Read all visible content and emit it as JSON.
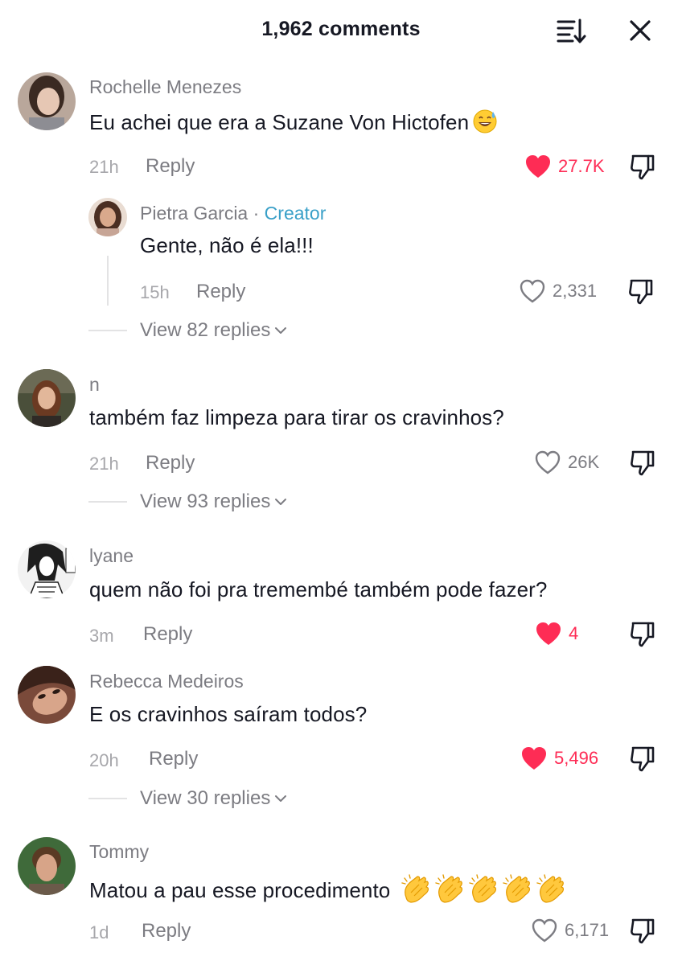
{
  "header": {
    "title": "1,962 comments"
  },
  "comments": [
    {
      "username": "Rochelle Menezes",
      "text": "Eu achei que era a Suzane Von Hictofen",
      "time": "21h",
      "reply_label": "Reply",
      "likes": "27.7K",
      "liked": true,
      "avatar_colors": [
        "#c9b3a3",
        "#3a2a22",
        "#e8d2c3"
      ],
      "replies": [
        {
          "username": "Pietra Garcia",
          "separator": "·",
          "badge": "Creator",
          "text": "Gente, não é ela!!!",
          "time": "15h",
          "reply_label": "Reply",
          "likes": "2,331",
          "liked": false
        }
      ],
      "view_replies": "View 82 replies"
    },
    {
      "username": "n",
      "text": "também faz limpeza para tirar os cravinhos?",
      "time": "21h",
      "reply_label": "Reply",
      "likes": "26K",
      "liked": false,
      "view_replies": "View 93 replies"
    },
    {
      "username": "lyane",
      "text": "quem não foi pra tremembé também pode fazer?",
      "time": "3m",
      "reply_label": "Reply",
      "likes": "4",
      "liked": true
    },
    {
      "username": "Rebecca Medeiros",
      "text": "E os cravinhos saíram todos?",
      "time": "20h",
      "reply_label": "Reply",
      "likes": "5,496",
      "liked": true,
      "view_replies": "View 30 replies"
    },
    {
      "username": "Tommy",
      "text": "Matou a pau esse procedimento",
      "time": "1d",
      "reply_label": "Reply",
      "likes": "6,171",
      "liked": false
    }
  ],
  "colors": {
    "like_active": "#fe2c55",
    "creator_badge": "#3aa0c8",
    "secondary_text": "#7c7c82"
  },
  "icons": {
    "sort": "sort-icon",
    "close": "close-icon",
    "heart": "heart-icon",
    "dislike": "dislike-icon",
    "chevron": "chevron-down-icon",
    "sweat_smile": "sweat-smile-emoji",
    "clap": "clapping-hands-emoji"
  }
}
